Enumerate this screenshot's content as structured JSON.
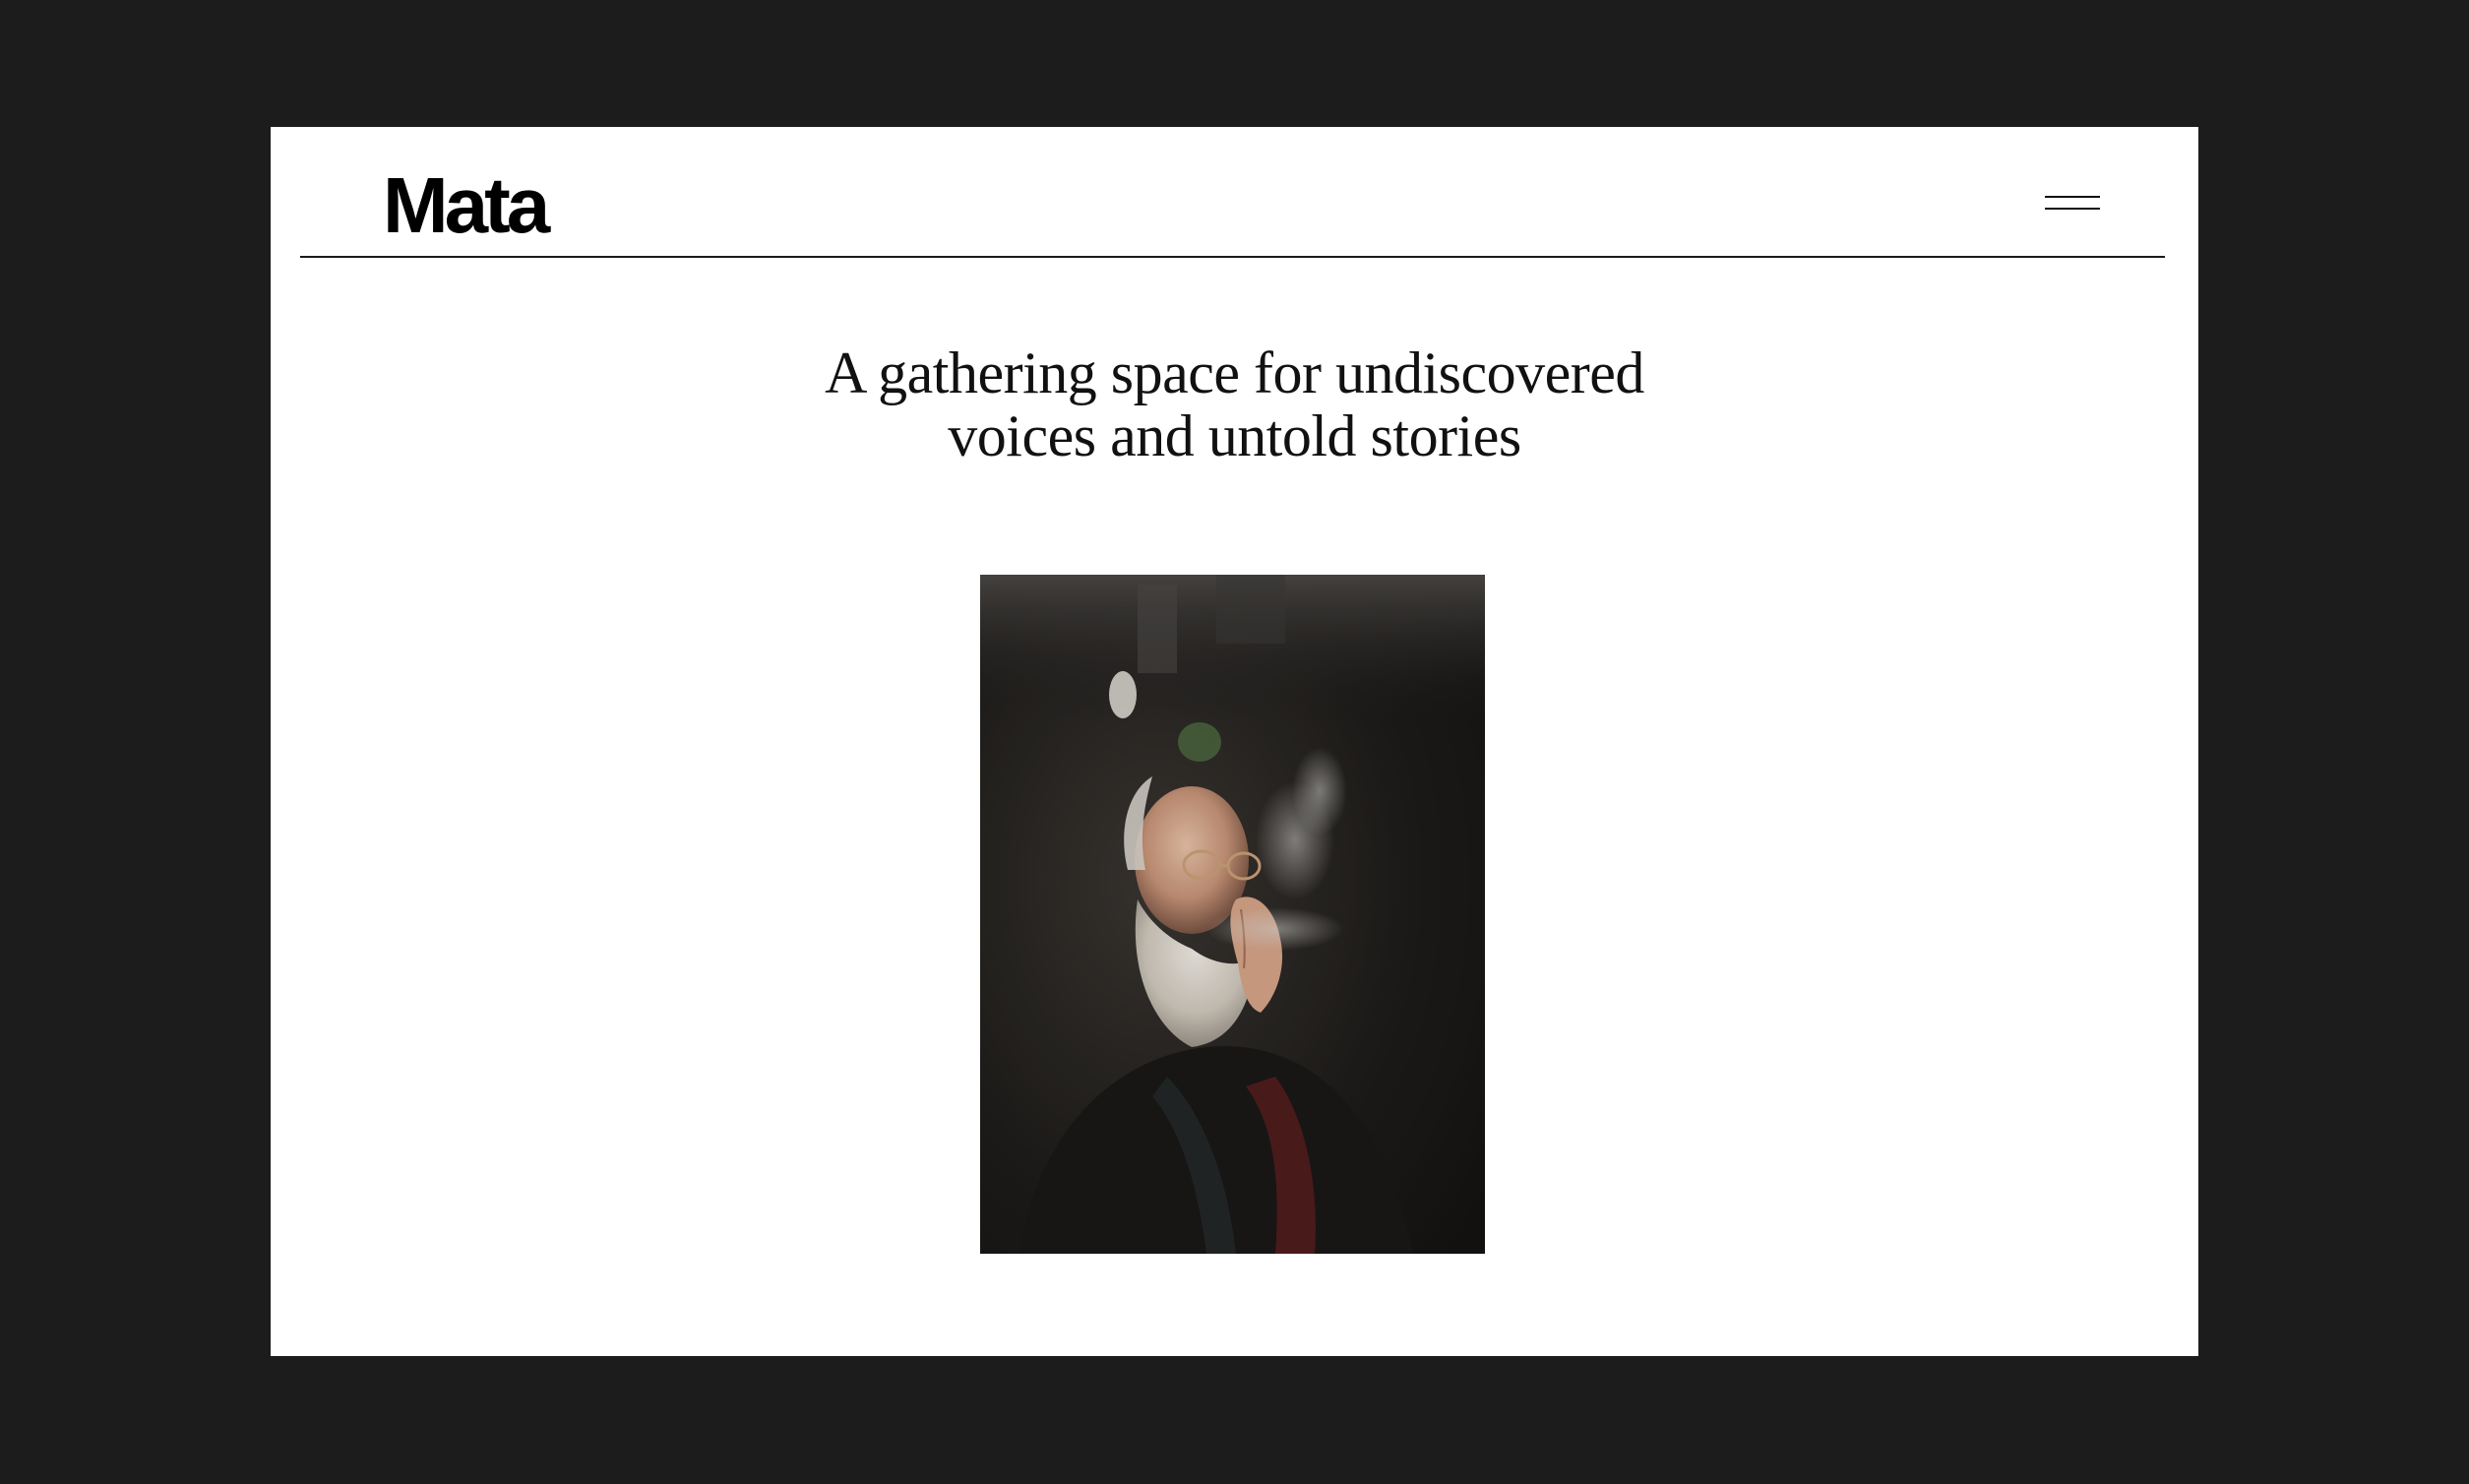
{
  "site": {
    "logo": "Mata"
  },
  "header": {
    "menu_icon": "hamburger-menu-icon"
  },
  "hero": {
    "headline_line1": "A gathering space for undiscovered",
    "headline_line2": "voices and untold stories"
  },
  "photo": {
    "subject": "portrait-photo"
  },
  "colors": {
    "background": "#1c1c1c",
    "card": "#ffffff",
    "text": "#111111"
  }
}
